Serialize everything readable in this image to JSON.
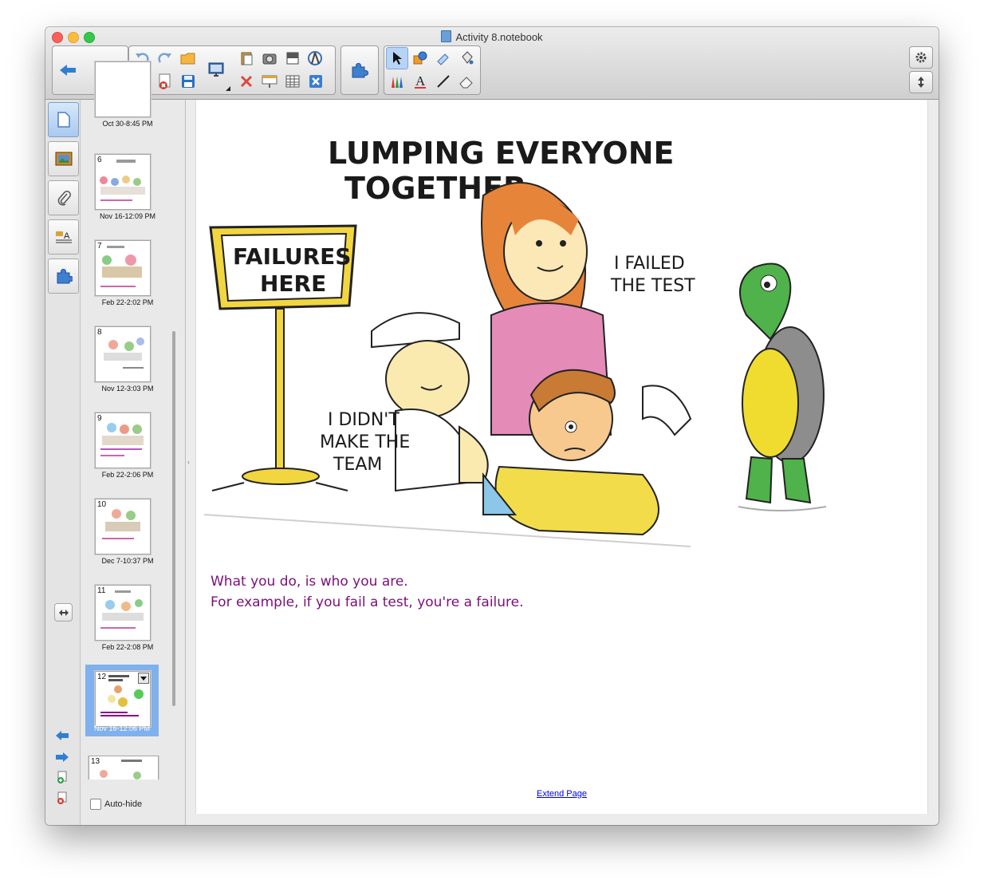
{
  "window": {
    "title": "Activity 8.notebook"
  },
  "toolbar": {
    "back_icon": "arrow-left-icon",
    "forward_icon": "arrow-right-icon",
    "accent": "#2e7fd3"
  },
  "side_tabs": [
    {
      "name": "page-sorter-tab",
      "icon": "page-icon",
      "active": true
    },
    {
      "name": "gallery-tab",
      "icon": "picture-icon",
      "active": false
    },
    {
      "name": "attachments-tab",
      "icon": "paperclip-icon",
      "active": false
    },
    {
      "name": "properties-tab",
      "icon": "properties-icon",
      "active": false
    },
    {
      "name": "addons-tab",
      "icon": "puzzle-icon",
      "active": false
    }
  ],
  "sorter": {
    "pages": [
      {
        "num": "",
        "caption": "Oct 30-8:45 PM"
      },
      {
        "num": "6",
        "caption": "Nov 16-12:09 PM"
      },
      {
        "num": "7",
        "caption": "Feb 22-2:02 PM"
      },
      {
        "num": "8",
        "caption": "Nov 12-3:03 PM"
      },
      {
        "num": "9",
        "caption": "Feb 22-2:06 PM"
      },
      {
        "num": "10",
        "caption": "Dec 7-10:37 PM"
      },
      {
        "num": "11",
        "caption": "Feb 22-2:08 PM"
      },
      {
        "num": "12",
        "caption": "Nov 16-12:06 PM"
      },
      {
        "num": "13",
        "caption": ""
      }
    ],
    "autohide_label": "Auto-hide"
  },
  "canvas": {
    "cartoon": {
      "heading_line1": "LUMPING EVERYONE",
      "heading_line2": "TOGETHER",
      "sign_line1": "FAILURES",
      "sign_line2": "HERE",
      "bubble_failed_1": "I FAILED",
      "bubble_failed_2": "THE TEST",
      "bubble_team_1": "I DIDN'T",
      "bubble_team_2": "MAKE THE",
      "bubble_team_3": "TEAM"
    },
    "caption_line1": "What you do, is who you are.",
    "caption_line2": "For example, if you fail a test, you're a failure.",
    "extend_link": "Extend Page"
  }
}
